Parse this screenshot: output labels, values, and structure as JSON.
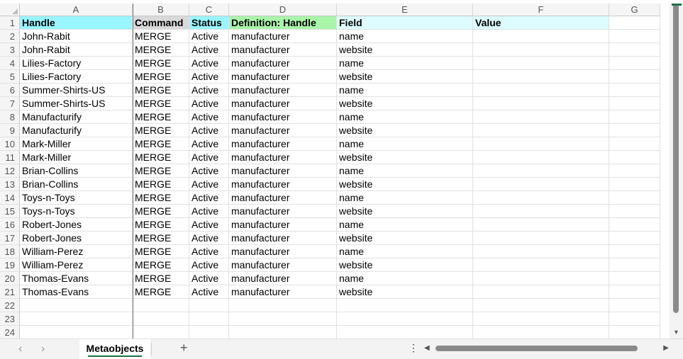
{
  "columns": [
    "A",
    "B",
    "C",
    "D",
    "E",
    "F",
    "G"
  ],
  "header_row": {
    "A": "Handle",
    "B": "Command",
    "C": "Status",
    "D": "Definition: Handle",
    "E": "Field",
    "F": "Value",
    "G": ""
  },
  "header_colors": {
    "A": "#99f5ff",
    "B": "#d9d9d9",
    "C": "#99f5ff",
    "D": "#a9f5a9",
    "E": "#dcfcff",
    "F": "#dcfcff"
  },
  "rows": [
    [
      "John-Rabit",
      "MERGE",
      "Active",
      "manufacturer",
      "name"
    ],
    [
      "John-Rabit",
      "MERGE",
      "Active",
      "manufacturer",
      "website"
    ],
    [
      "Lilies-Factory",
      "MERGE",
      "Active",
      "manufacturer",
      "name"
    ],
    [
      "Lilies-Factory",
      "MERGE",
      "Active",
      "manufacturer",
      "website"
    ],
    [
      "Summer-Shirts-US",
      "MERGE",
      "Active",
      "manufacturer",
      "name"
    ],
    [
      "Summer-Shirts-US",
      "MERGE",
      "Active",
      "manufacturer",
      "website"
    ],
    [
      "Manufacturify",
      "MERGE",
      "Active",
      "manufacturer",
      "name"
    ],
    [
      "Manufacturify",
      "MERGE",
      "Active",
      "manufacturer",
      "website"
    ],
    [
      "Mark-Miller",
      "MERGE",
      "Active",
      "manufacturer",
      "name"
    ],
    [
      "Mark-Miller",
      "MERGE",
      "Active",
      "manufacturer",
      "website"
    ],
    [
      "Brian-Collins",
      "MERGE",
      "Active",
      "manufacturer",
      "name"
    ],
    [
      "Brian-Collins",
      "MERGE",
      "Active",
      "manufacturer",
      "website"
    ],
    [
      "Toys-n-Toys",
      "MERGE",
      "Active",
      "manufacturer",
      "name"
    ],
    [
      "Toys-n-Toys",
      "MERGE",
      "Active",
      "manufacturer",
      "website"
    ],
    [
      "Robert-Jones",
      "MERGE",
      "Active",
      "manufacturer",
      "name"
    ],
    [
      "Robert-Jones",
      "MERGE",
      "Active",
      "manufacturer",
      "website"
    ],
    [
      "William-Perez",
      "MERGE",
      "Active",
      "manufacturer",
      "name"
    ],
    [
      "William-Perez",
      "MERGE",
      "Active",
      "manufacturer",
      "website"
    ],
    [
      "Thomas-Evans",
      "MERGE",
      "Active",
      "manufacturer",
      "name"
    ],
    [
      "Thomas-Evans",
      "MERGE",
      "Active",
      "manufacturer",
      "website"
    ]
  ],
  "row_numbers": [
    "1",
    "2",
    "3",
    "4",
    "5",
    "6",
    "7",
    "8",
    "9",
    "10",
    "11",
    "12",
    "13",
    "14",
    "15",
    "16",
    "17",
    "18",
    "19",
    "20",
    "21",
    "22",
    "23",
    "24"
  ],
  "sheet_tabs": [
    {
      "label": "Metaobjects",
      "active": true
    }
  ],
  "add_sheet_label": "+",
  "nav": {
    "prev": "‹",
    "next": "›",
    "more": "⋮"
  },
  "accent_color": "#1e7145"
}
